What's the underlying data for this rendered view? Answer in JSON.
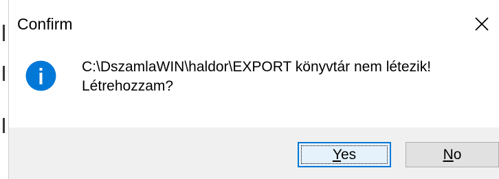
{
  "window": {
    "title": "Confirm"
  },
  "message": {
    "line1": "C:\\DszamlaWIN\\haldor\\EXPORT könyvtár nem létezik!",
    "line2": "Létrehozzam?"
  },
  "buttons": {
    "yes": {
      "accel": "Y",
      "rest": "es"
    },
    "no": {
      "accel": "N",
      "rest": "o"
    }
  },
  "icons": {
    "info": "info-icon",
    "close": "close-icon"
  },
  "colors": {
    "info_blue": "#0078d7",
    "footer_bg": "#f0f0f0",
    "focus_border": "#0078d7"
  }
}
